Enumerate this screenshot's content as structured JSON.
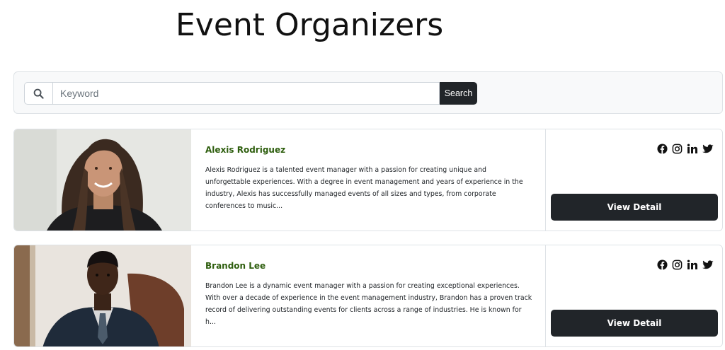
{
  "page": {
    "title": "Event Organizers"
  },
  "search": {
    "placeholder": "Keyword",
    "value": "",
    "button_label": "Search"
  },
  "organizers": [
    {
      "name": "Alexis Rodriguez",
      "description": "Alexis Rodriguez is a talented event manager with a passion for creating unique and unforgettable experiences. With a degree in event management and years of experience in the industry, Alexis has successfully managed events of all sizes and types, from corporate conferences to music...",
      "button_label": "View Detail",
      "social_icons": [
        "facebook-icon",
        "instagram-icon",
        "linkedin-icon",
        "twitter-icon"
      ]
    },
    {
      "name": "Brandon Lee",
      "description": "Brandon Lee is a dynamic event manager with a passion for creating exceptional experiences. With over a decade of experience in the event management industry, Brandon has a proven track record of delivering outstanding events for clients across a range of industries. He is known for h...",
      "button_label": "View Detail",
      "social_icons": [
        "facebook-icon",
        "instagram-icon",
        "linkedin-icon",
        "twitter-icon"
      ]
    }
  ],
  "colors": {
    "name_accent": "#2e5e0e",
    "dark_button": "#212529",
    "panel_background": "#f8f9fa"
  }
}
